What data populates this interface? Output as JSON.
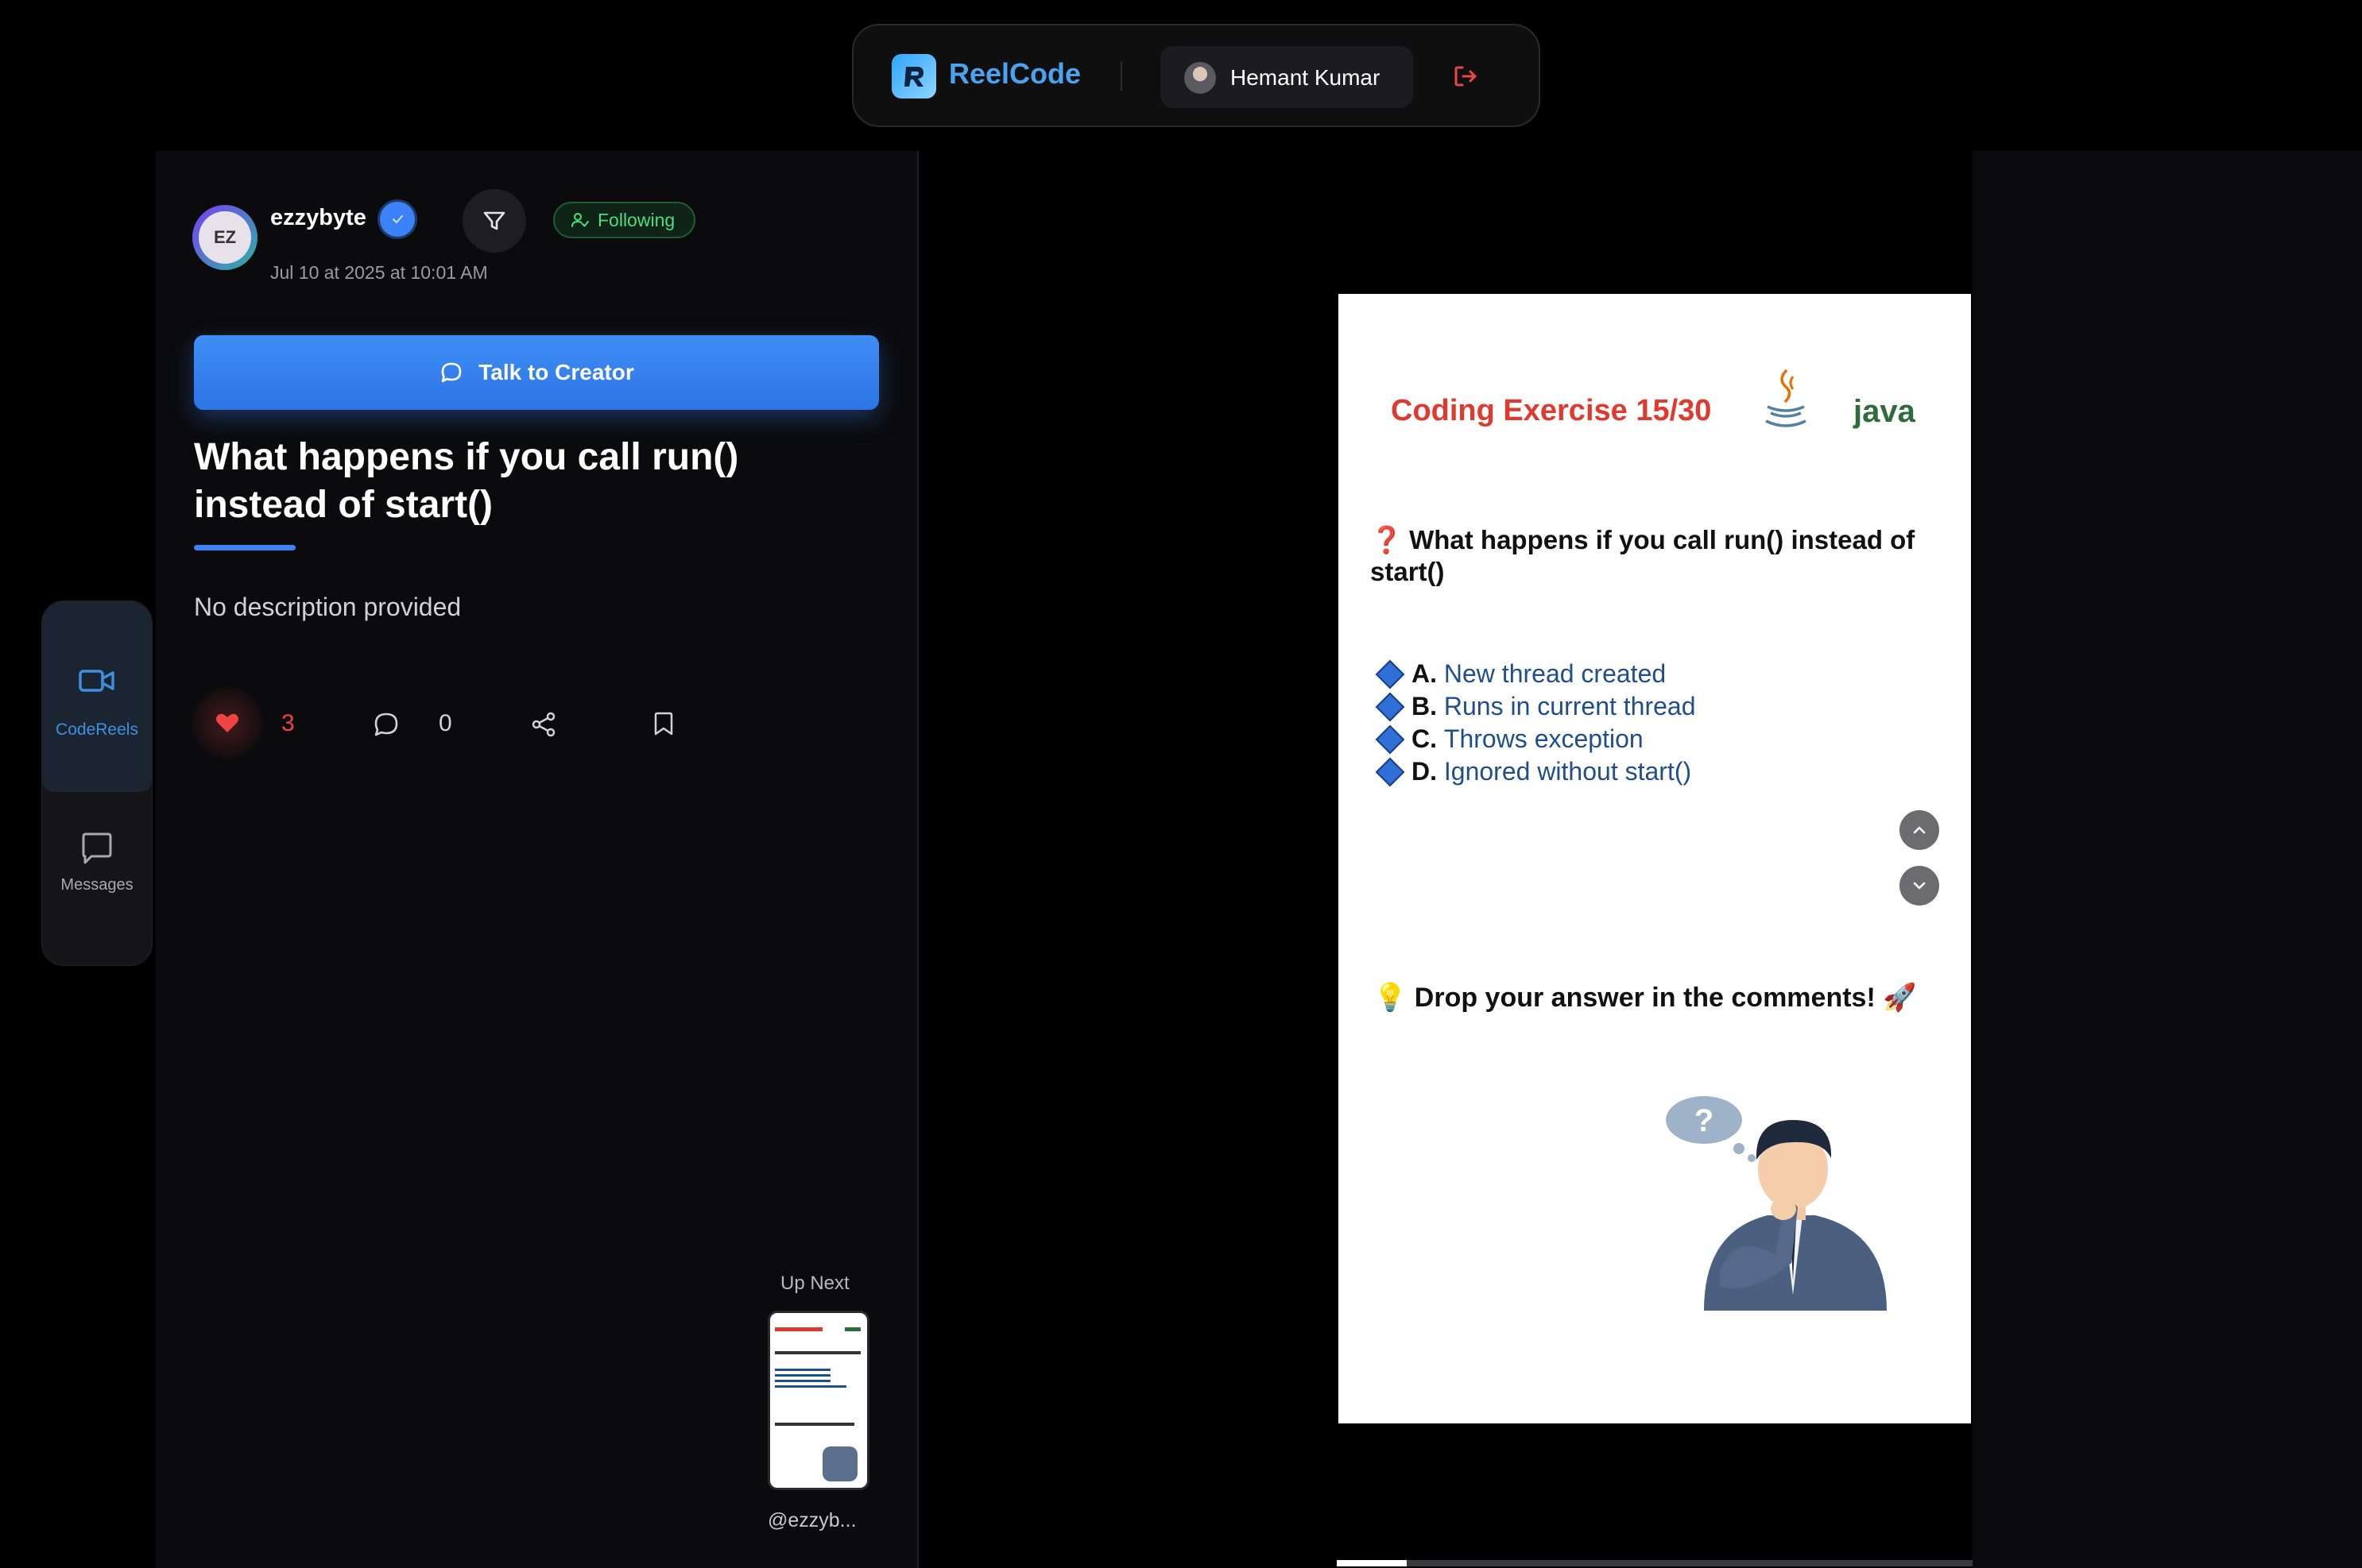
{
  "header": {
    "brand": "ReelCode",
    "user_name": "Hemant Kumar"
  },
  "rail": {
    "items": [
      {
        "label": "CodeReels",
        "icon": "video-camera-icon",
        "active": true
      },
      {
        "label": "Messages",
        "icon": "chat-bubble-icon",
        "active": false
      }
    ]
  },
  "post": {
    "creator": "ezzybyte",
    "creator_initials": "EZ",
    "date": "Jul 10 at 2025 at 10:01 AM",
    "following_label": "Following",
    "talk_button": "Talk to Creator",
    "title": "What happens if you call run() instead of start()",
    "description": "No description provided",
    "likes": "3",
    "comments": "0"
  },
  "up_next": {
    "label": "Up Next",
    "handle": "@ezzyb..."
  },
  "reel": {
    "title": "Coding Exercise  15/30",
    "language": "java",
    "question_mark": "❓",
    "question": "What happens if you call run() instead of start()",
    "options": [
      {
        "letter": "A.",
        "text": "New thread created"
      },
      {
        "letter": "B.",
        "text": "Runs in current thread"
      },
      {
        "letter": "C.",
        "text": "Throws exception"
      },
      {
        "letter": "D.",
        "text": "Ignored without start()"
      }
    ],
    "cta": "💡 Drop your answer in the comments! 🚀"
  },
  "playback": {
    "progress_fraction": 0.11
  },
  "colors": {
    "accent": "#3b82f6",
    "like": "#ef4444",
    "following": "#4ade80",
    "reel_title": "#e03a2e",
    "java": "#2f6b3b"
  }
}
